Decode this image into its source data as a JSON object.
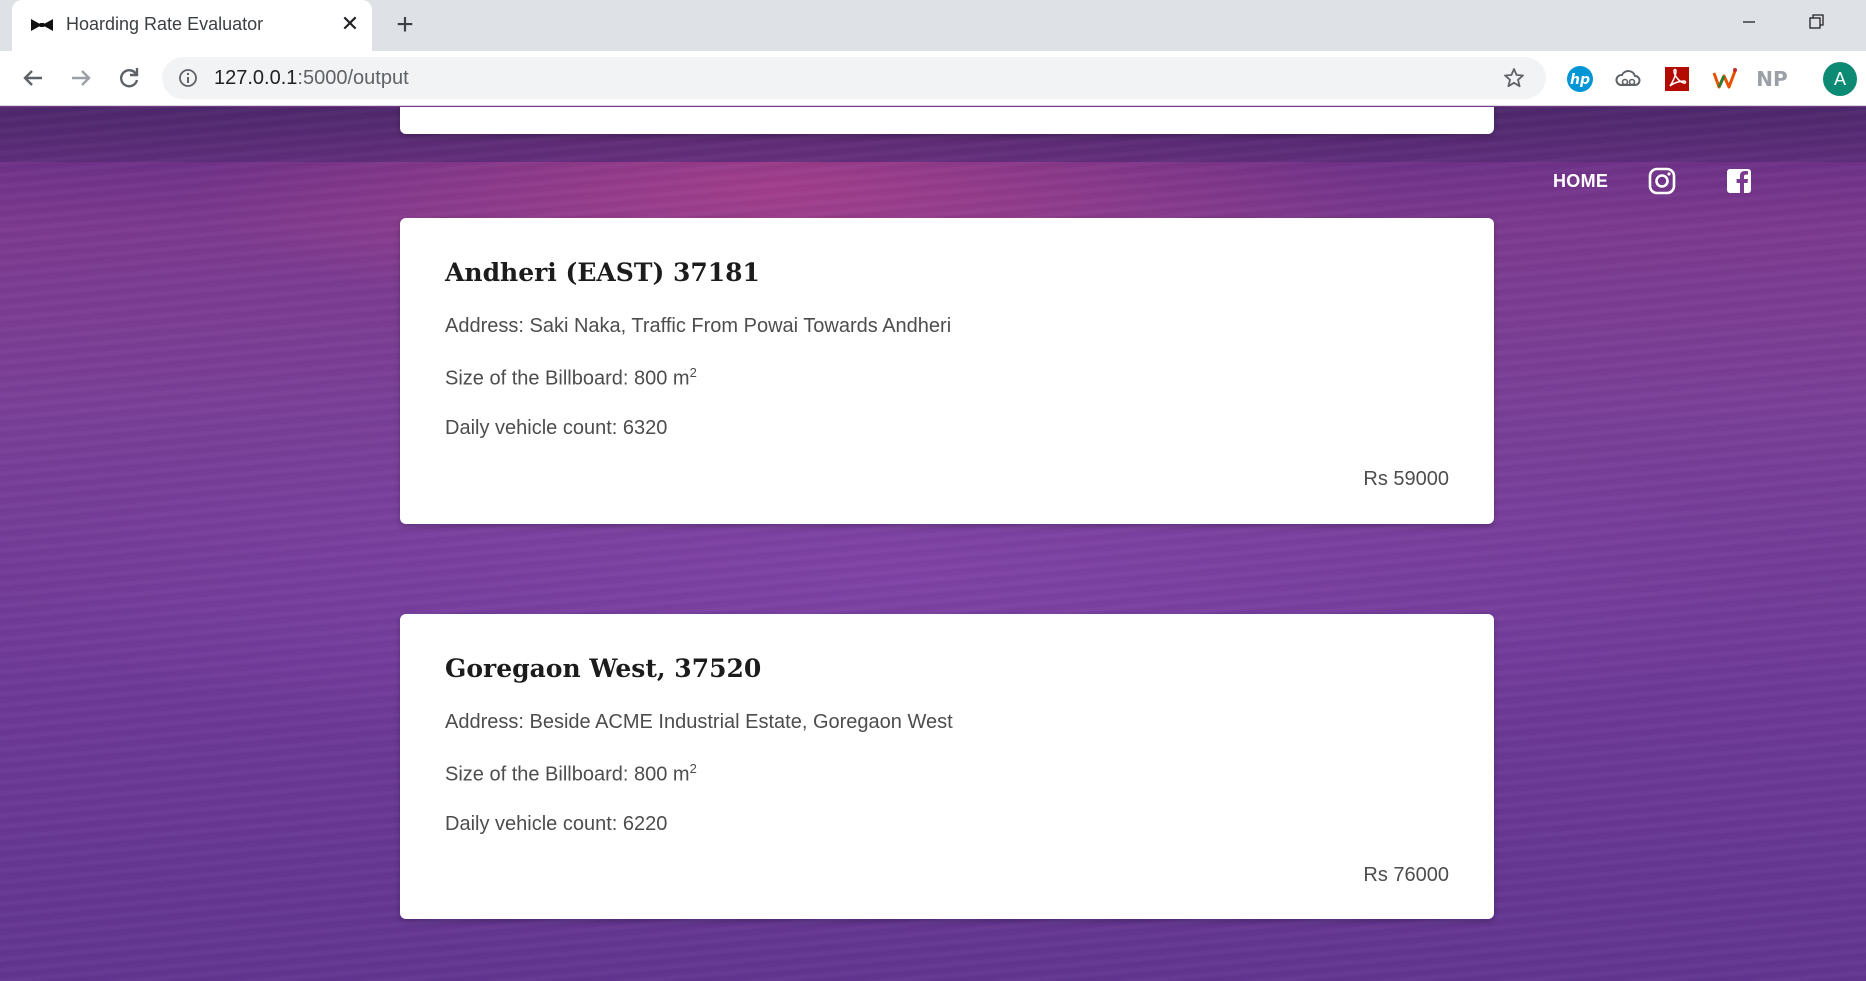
{
  "browser": {
    "tab_title": "Hoarding Rate Evaluator",
    "tab_close": "✕",
    "new_tab": "+",
    "url_host": "127.0.0.1",
    "url_path": ":5000/output",
    "extension_np": "NP",
    "avatar_letter": "A"
  },
  "nav": {
    "home_label": "HOME",
    "icons": [
      "instagram-icon",
      "facebook-icon"
    ]
  },
  "listings": [
    {
      "title": "Andheri (EAST) 37181",
      "address_label": "Address: ",
      "address": "Saki Naka, Traffic From Powai Towards Andheri",
      "size_label": "Size of the Billboard: ",
      "size": "800 m",
      "size_exp": "2",
      "count_label": "Daily vehicle count: ",
      "count": "6320",
      "price": "Rs 59000"
    },
    {
      "title": "Goregaon West, 37520",
      "address_label": "Address: ",
      "address": "Beside ACME Industrial Estate, Goregaon West",
      "size_label": "Size of the Billboard: ",
      "size": "800 m",
      "size_exp": "2",
      "count_label": "Daily vehicle count: ",
      "count": "6220",
      "price": "Rs 76000"
    }
  ],
  "colors": {
    "background": "#7a3a8e",
    "card": "#ffffff",
    "avatar": "#0d8a73",
    "hp_blue": "#0096d6",
    "pdf_red": "#b30b00"
  }
}
